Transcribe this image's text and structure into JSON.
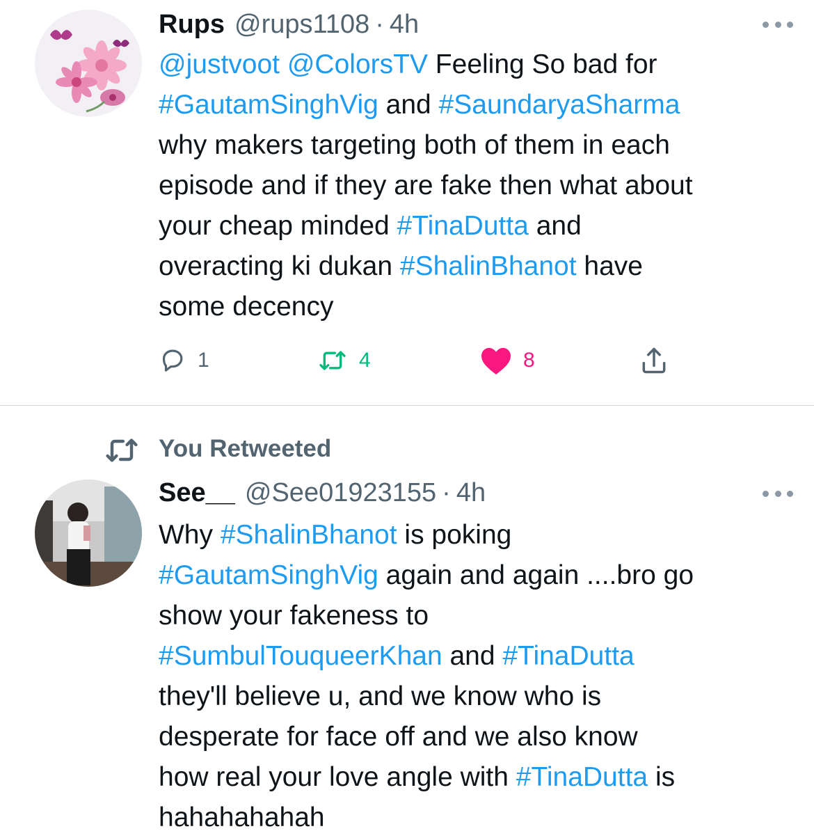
{
  "tweets": [
    {
      "author_name": "Rups",
      "author_handle": "@rups1108",
      "separator": "·",
      "time": "4h",
      "lines": [
        [
          {
            "t": "@justvoot",
            "tag": true
          },
          {
            "t": " "
          },
          {
            "t": "@ColorsTV",
            "tag": true
          },
          {
            "t": " Feeling So bad for"
          }
        ],
        [
          {
            "t": "#GautamSinghVig",
            "tag": true
          },
          {
            "t": " and "
          },
          {
            "t": "#SaundaryaSharma",
            "tag": true
          }
        ],
        [
          {
            "t": "why makers targeting both of them in each"
          }
        ],
        [
          {
            "t": "episode and if they are fake then what about"
          }
        ],
        [
          {
            "t": "your cheap minded "
          },
          {
            "t": "#TinaDutta",
            "tag": true
          },
          {
            "t": " and"
          }
        ],
        [
          {
            "t": "overacting ki dukan "
          },
          {
            "t": "#ShalinBhanot",
            "tag": true
          },
          {
            "t": " have"
          }
        ],
        [
          {
            "t": "some decency"
          }
        ]
      ],
      "actions": {
        "reply_count": "1",
        "retweet_count": "4",
        "like_count": "8"
      },
      "colors": {
        "retweet": "#00ba7c",
        "like": "#f91880",
        "reply": "#536471"
      }
    },
    {
      "context_label": "You Retweeted",
      "author_name": "See__",
      "author_handle": "@See01923155",
      "separator": "·",
      "time": "4h",
      "lines": [
        [
          {
            "t": "Why "
          },
          {
            "t": "#ShalinBhanot",
            "tag": true
          },
          {
            "t": " is poking"
          }
        ],
        [
          {
            "t": "#GautamSinghVig",
            "tag": true
          },
          {
            "t": " again and again ....bro go"
          }
        ],
        [
          {
            "t": "show your fakeness to"
          }
        ],
        [
          {
            "t": "#SumbulTouqueerKhan",
            "tag": true
          },
          {
            "t": " and "
          },
          {
            "t": "#TinaDutta",
            "tag": true
          }
        ],
        [
          {
            "t": "they'll believe u, and we know who is"
          }
        ],
        [
          {
            "t": "desperate for face off and we also know"
          }
        ],
        [
          {
            "t": "how real your love angle with "
          },
          {
            "t": "#TinaDutta",
            "tag": true
          },
          {
            "t": " is"
          }
        ],
        [
          {
            "t": "hahahahahah"
          }
        ]
      ]
    }
  ],
  "icons": {
    "more": "more-horizontal-icon",
    "reply": "reply-bubble-icon",
    "retweet": "retweet-icon",
    "like": "heart-icon",
    "share": "share-icon"
  },
  "theme": {
    "hashtag": "#1d9bf0",
    "secondary_text": "#536471",
    "divider": "#cfd9de"
  }
}
